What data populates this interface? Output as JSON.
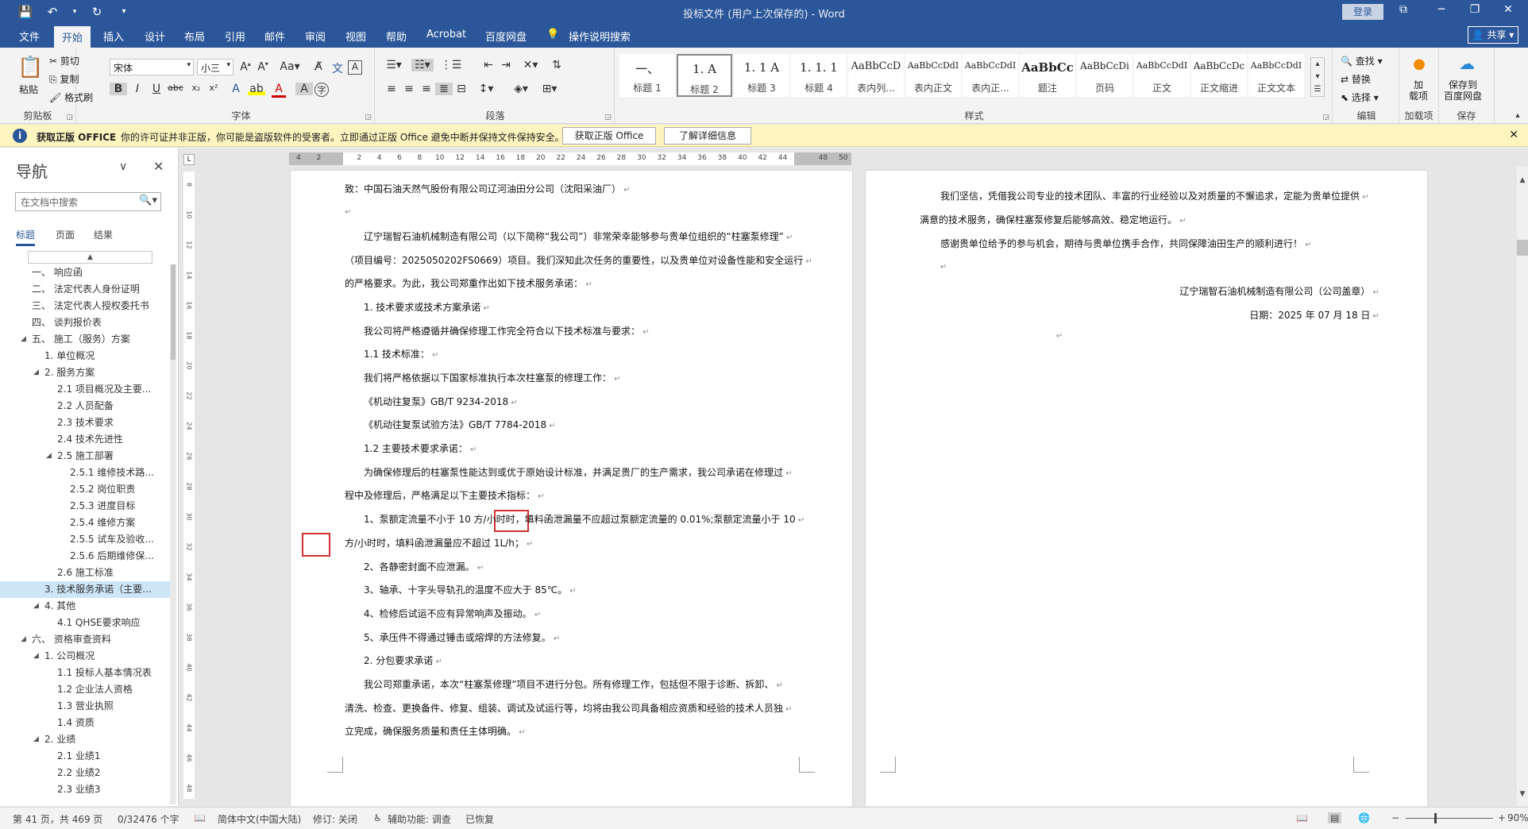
{
  "window": {
    "title": "投标文件 (用户上次保存的) - Word",
    "login": "登录"
  },
  "tabs": [
    "文件",
    "开始",
    "插入",
    "设计",
    "布局",
    "引用",
    "邮件",
    "审阅",
    "视图",
    "帮助",
    "Acrobat",
    "百度网盘",
    "操作说明搜索"
  ],
  "share": "共享",
  "ribbon": {
    "clipboard": {
      "paste": "粘贴",
      "cut": "剪切",
      "copy": "复制",
      "format_painter": "格式刷",
      "label": "剪贴板"
    },
    "font": {
      "name": "宋体",
      "size": "小三",
      "label": "字体"
    },
    "paragraph": {
      "label": "段落"
    },
    "styles": {
      "label": "样式",
      "items": [
        {
          "sample": "一、",
          "name": "标题 1"
        },
        {
          "sample": "1.  A",
          "name": "标题 2"
        },
        {
          "sample": "1. 1  A",
          "name": "标题 3"
        },
        {
          "sample": "1. 1. 1",
          "name": "标题 4"
        },
        {
          "sample": "AaBbCcD",
          "name": "表内列..."
        },
        {
          "sample": "AaBbCcDdI",
          "name": "表内正文"
        },
        {
          "sample": "AaBbCcDdI",
          "name": "表内正..."
        },
        {
          "sample": "AaBbCc",
          "name": "题注"
        },
        {
          "sample": "AaBbCcDi",
          "name": "页码"
        },
        {
          "sample": "AaBbCcDdI",
          "name": "正文"
        },
        {
          "sample": "AaBbCcDc",
          "name": "正文缩进"
        },
        {
          "sample": "AaBbCcDdI",
          "name": "正文文本"
        }
      ]
    },
    "editing": {
      "find": "查找",
      "replace": "替换",
      "select": "选择",
      "label": "编辑"
    },
    "addins": {
      "add": "加\n载项",
      "label": "加载项"
    },
    "save": {
      "baidu": "保存到\n百度网盘",
      "label": "保存"
    }
  },
  "infobar": {
    "title": "获取正版 OFFICE",
    "message": "你的许可证并非正版，你可能是盗版软件的受害者。立即通过正版 Office 避免中断并保持文件保持安全。",
    "btn_get": "获取正版 Office",
    "btn_learn": "了解详细信息"
  },
  "nav": {
    "title": "导航",
    "search_placeholder": "在文档中搜索",
    "tabs": [
      "标题",
      "页面",
      "结果"
    ],
    "items": [
      {
        "text": "一、 响应函",
        "level": 1,
        "tri": ""
      },
      {
        "text": "二、 法定代表人身份证明",
        "level": 1,
        "tri": ""
      },
      {
        "text": "三、 法定代表人授权委托书",
        "level": 1,
        "tri": ""
      },
      {
        "text": "四、 谈判报价表",
        "level": 1,
        "tri": ""
      },
      {
        "text": "五、 施工（服务）方案",
        "level": 1,
        "tri": "◢"
      },
      {
        "text": "1. 单位概况",
        "level": 2,
        "tri": ""
      },
      {
        "text": "2. 服务方案",
        "level": 2,
        "tri": "◢"
      },
      {
        "text": "2.1 项目概况及主要...",
        "level": 3,
        "tri": ""
      },
      {
        "text": "2.2 人员配备",
        "level": 3,
        "tri": ""
      },
      {
        "text": "2.3 技术要求",
        "level": 3,
        "tri": ""
      },
      {
        "text": "2.4 技术先进性",
        "level": 3,
        "tri": ""
      },
      {
        "text": "2.5 施工部署",
        "level": 3,
        "tri": "◢"
      },
      {
        "text": "2.5.1 维修技术路...",
        "level": 4,
        "tri": ""
      },
      {
        "text": "2.5.2 岗位职责",
        "level": 4,
        "tri": ""
      },
      {
        "text": "2.5.3 进度目标",
        "level": 4,
        "tri": ""
      },
      {
        "text": "2.5.4 维修方案",
        "level": 4,
        "tri": ""
      },
      {
        "text": "2.5.5 试车及验收...",
        "level": 4,
        "tri": ""
      },
      {
        "text": "2.5.6 后期维修保...",
        "level": 4,
        "tri": ""
      },
      {
        "text": "2.6 施工标准",
        "level": 3,
        "tri": ""
      },
      {
        "text": "3. 技术服务承诺（主要...",
        "level": 2,
        "tri": "",
        "current": true
      },
      {
        "text": "4. 其他",
        "level": 2,
        "tri": "◢"
      },
      {
        "text": "4.1 QHSE要求响应",
        "level": 3,
        "tri": ""
      },
      {
        "text": "六、 资格审查资料",
        "level": 1,
        "tri": "◢"
      },
      {
        "text": "1. 公司概况",
        "level": 2,
        "tri": "◢"
      },
      {
        "text": "1.1 投标人基本情况表",
        "level": 3,
        "tri": ""
      },
      {
        "text": "1.2 企业法人资格",
        "level": 3,
        "tri": ""
      },
      {
        "text": "1.3 营业执照",
        "level": 3,
        "tri": ""
      },
      {
        "text": "1.4 资质",
        "level": 3,
        "tri": ""
      },
      {
        "text": "2. 业绩",
        "level": 2,
        "tri": "◢"
      },
      {
        "text": "2.1 业绩1",
        "level": 3,
        "tri": ""
      },
      {
        "text": "2.2 业绩2",
        "level": 3,
        "tri": ""
      },
      {
        "text": "2.3 业绩3",
        "level": 3,
        "tri": ""
      }
    ]
  },
  "ruler": {
    "h_ticks": [
      "4",
      "2",
      "",
      "2",
      "4",
      "6",
      "8",
      "10",
      "12",
      "14",
      "16",
      "18",
      "20",
      "22",
      "24",
      "26",
      "28",
      "30",
      "32",
      "34",
      "36",
      "38",
      "40",
      "42",
      "44",
      "",
      "48",
      "50"
    ],
    "v_ticks": [
      "8",
      "10",
      "12",
      "14",
      "16",
      "18",
      "20",
      "22",
      "24",
      "26",
      "28",
      "30",
      "32",
      "34",
      "36",
      "38",
      "40",
      "42",
      "44",
      "46",
      "48"
    ]
  },
  "page1": {
    "lines": [
      "致：中国石油天然气股份有限公司辽河油田分公司（沈阳采油厂）",
      "",
      "辽宁瑞智石油机械制造有限公司（以下简称“我公司”）非常荣幸能够参与贵单位组织的“柱塞泵修理”",
      "（项目编号：2025050202FS0669）项目。我们深知此次任务的重要性，以及贵单位对设备性能和安全运行",
      "的严格要求。为此，我公司郑重作出如下技术服务承诺：",
      "1.  技术要求或技术方案承诺",
      "我公司将严格遵循并确保修理工作完全符合以下技术标准与要求：",
      "1.1 技术标准：",
      "我们将严格依据以下国家标准执行本次柱塞泵的修理工作：",
      "《机动往复泵》GB/T 9234-2018",
      "《机动往复泵试验方法》GB/T 7784-2018",
      "1.2 主要技术要求承诺：",
      "为确保修理后的柱塞泵性能达到或优于原始设计标准，并满足贵厂的生产需求，我公司承诺在修理过",
      "程中及修理后，严格满足以下主要技术指标：",
      "1、泵额定流量不小于 10 方/小时时，填料函泄漏量不应超过泵额定流量的 0.01%;泵额定流量小于 10",
      "方/小时时，填料函泄漏量应不超过 1L/h；",
      "2、各静密封面不应泄漏。",
      "3、轴承、十字头导轨孔的温度不应大于 85℃。",
      "4、检修后试运不应有异常响声及振动。",
      "5、承压件不得通过锤击或熔焊的方法修复。",
      "2.  分包要求承诺",
      "我公司郑重承诺，本次“柱塞泵修理”项目不进行分包。所有修理工作，包括但不限于诊断、拆卸、",
      "清洗、检查、更换备件、修复、组装、调试及试运行等，均将由我公司具备相应资质和经验的技术人员独",
      "立完成，确保服务质量和责任主体明确。"
    ]
  },
  "page2": {
    "lines": [
      "我们坚信，凭借我公司专业的技术团队、丰富的行业经验以及对质量的不懈追求，定能为贵单位提供",
      "满意的技术服务，确保柱塞泵修复后能够高效、稳定地运行。",
      "感谢贵单位给予的参与机会，期待与贵单位携手合作，共同保障油田生产的顺利进行！",
      "",
      "辽宁瑞智石油机械制造有限公司（公司盖章）",
      "日期：2025 年 07 月 18 日"
    ]
  },
  "status": {
    "page": "第 41 页，共 469 页",
    "words": "0/32476 个字",
    "lang": "简体中文(中国大陆)",
    "track": "修订: 关闭",
    "access": "辅助功能: 调查",
    "recovered": "已恢复",
    "zoom": "90%"
  }
}
